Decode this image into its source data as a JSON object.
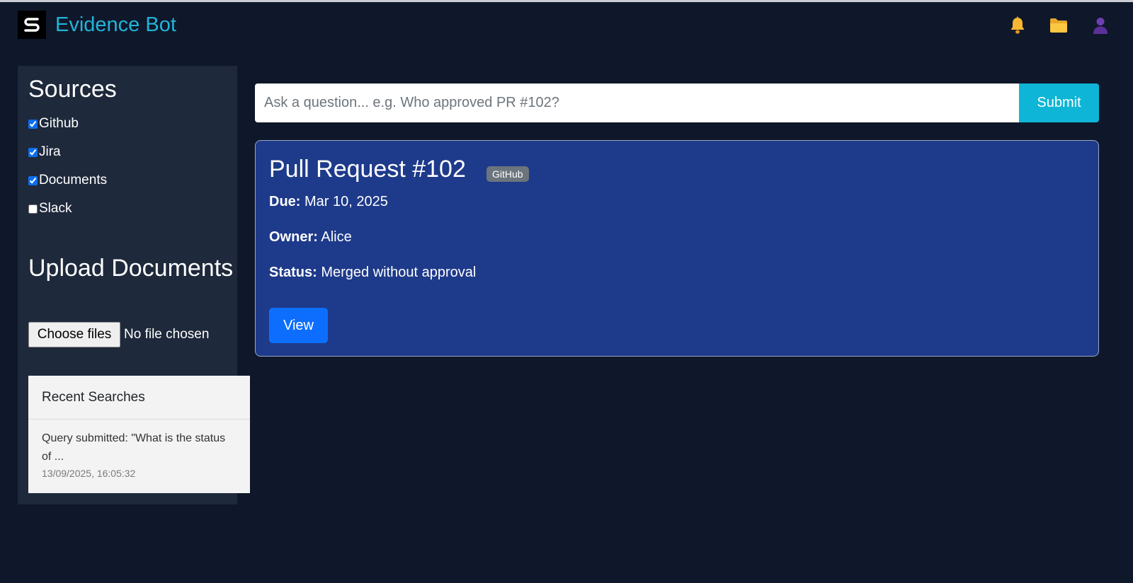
{
  "header": {
    "logo_letter": "S",
    "title": "Evidence Bot",
    "icons": [
      "bell-icon",
      "folder-icon",
      "user-icon"
    ]
  },
  "sidebar": {
    "sources_title": "Sources",
    "sources": [
      {
        "label": "Github",
        "checked": true
      },
      {
        "label": "Jira",
        "checked": true
      },
      {
        "label": "Documents",
        "checked": true
      },
      {
        "label": "Slack",
        "checked": false
      }
    ],
    "upload_title": "Upload Documents",
    "choose_files_label": "Choose files",
    "file_status": "No file chosen",
    "recent": {
      "title": "Recent Searches",
      "items": [
        {
          "query": "Query submitted: \"What is the status of ...",
          "time": "13/09/2025, 16:05:32"
        }
      ]
    }
  },
  "search": {
    "placeholder": "Ask a question... e.g. Who approved PR #102?",
    "value": "",
    "submit_label": "Submit"
  },
  "result": {
    "title": "Pull Request #102",
    "badge": "GitHub",
    "fields": [
      {
        "label": "Due:",
        "value": "Mar 10, 2025"
      },
      {
        "label": "Owner:",
        "value": "Alice"
      },
      {
        "label": "Status:",
        "value": "Merged without approval"
      }
    ],
    "view_label": "View"
  },
  "colors": {
    "background": "#0f172a",
    "sidebar": "#1e293b",
    "brand": "#22b4d8",
    "card": "#1e3a8a",
    "submit": "#0eb5d6",
    "view_button": "#0d6efd",
    "badge": "#6c757d"
  }
}
